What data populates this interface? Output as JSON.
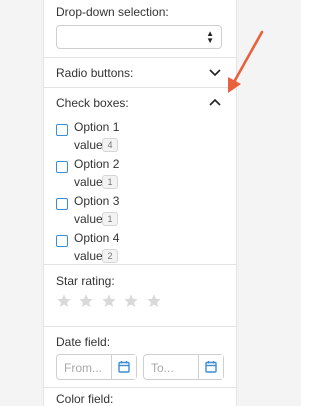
{
  "dropdown": {
    "label": "Drop-down selection:",
    "selected": ""
  },
  "radio": {
    "label": "Radio buttons:"
  },
  "checkboxes": {
    "label": "Check boxes:",
    "items": [
      {
        "label": "Option 1",
        "value_label": "value",
        "count": "4"
      },
      {
        "label": "Option 2",
        "value_label": "value",
        "count": "1"
      },
      {
        "label": "Option 3",
        "value_label": "value",
        "count": "1"
      },
      {
        "label": "Option 4",
        "value_label": "value",
        "count": "2"
      }
    ]
  },
  "star_rating": {
    "label": "Star rating:",
    "rating": 0,
    "max": 5
  },
  "date_field": {
    "label": "Date field:",
    "from_placeholder": "From...",
    "to_placeholder": "To..."
  },
  "color_field": {
    "label": "Color field:"
  },
  "colors": {
    "accent": "#3a8ed4",
    "arrow": "#e8613c",
    "star": "#d9d9d9"
  }
}
